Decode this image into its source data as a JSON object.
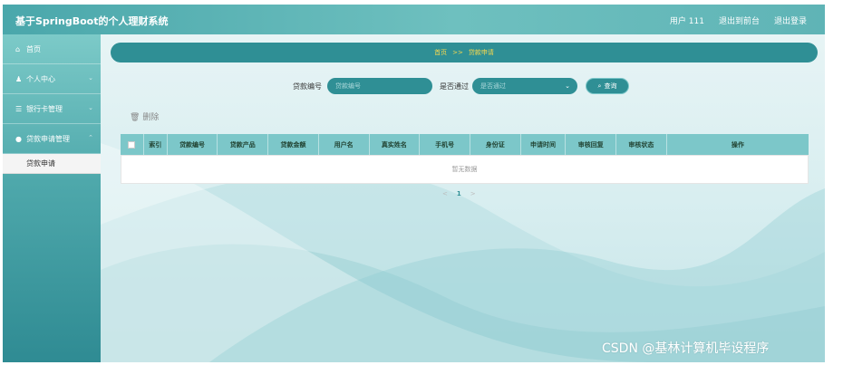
{
  "app": {
    "title": "基于SpringBoot的个人理财系统"
  },
  "top_right": {
    "user_label": "用户 111",
    "back_label": "退出到前台",
    "logout_label": "退出登录"
  },
  "sidebar": {
    "items": [
      {
        "label": "首页",
        "icon": "home-icon"
      },
      {
        "label": "个人中心",
        "icon": "user-icon"
      },
      {
        "label": "银行卡管理",
        "icon": "list-icon"
      },
      {
        "label": "贷款申请管理",
        "icon": "pin-icon"
      }
    ],
    "sub_items": [
      {
        "label": "贷款申请"
      }
    ]
  },
  "breadcrumb": {
    "home": "首页",
    "sep": ">>",
    "current": "贷款申请"
  },
  "search": {
    "loan_no_label": "贷款编号",
    "loan_no_placeholder": "贷款编号",
    "approved_label": "是否通过",
    "approved_placeholder": "是否通过",
    "query_label": "查询"
  },
  "toolbar": {
    "delete_label": "删除"
  },
  "table": {
    "columns": [
      "索引",
      "贷款编号",
      "贷款产品",
      "贷款金额",
      "用户名",
      "真实姓名",
      "手机号",
      "身份证",
      "申请时间",
      "审核回复",
      "审核状态",
      "操作"
    ],
    "empty_text": "暂无数据"
  },
  "pager": {
    "prev": "<",
    "page": "1",
    "next": ">"
  },
  "watermark": "CSDN @基林计算机毕设程序",
  "colors": {
    "accent": "#2f8f95",
    "header": "#7cc7c9",
    "breadcrumb_text": "#f7d84e"
  }
}
